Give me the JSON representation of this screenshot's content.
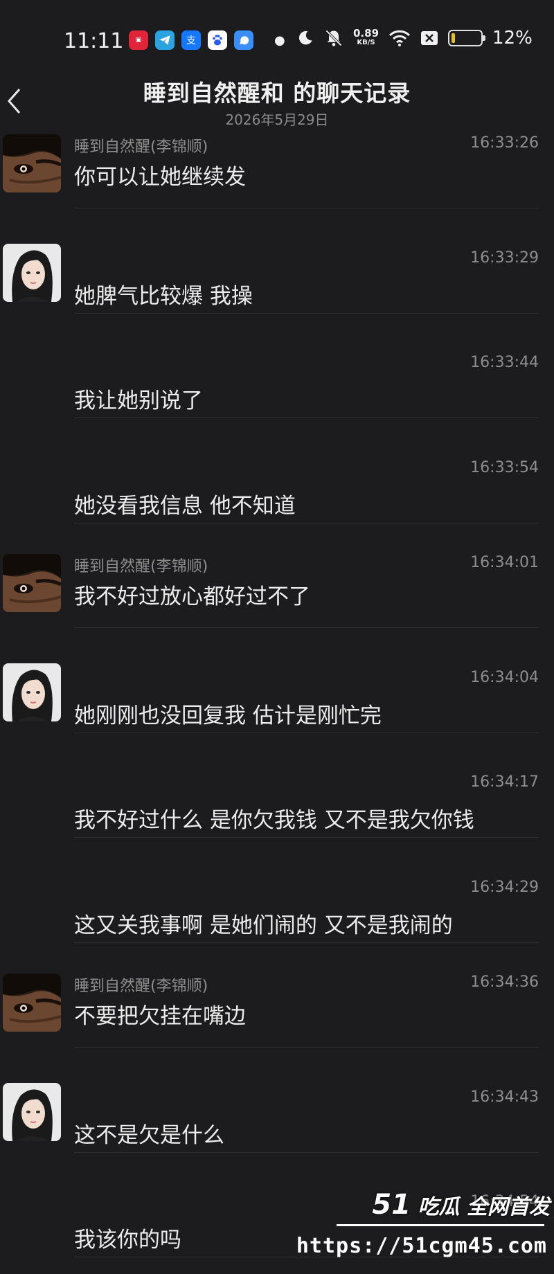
{
  "status_bar": {
    "time": "11:11",
    "net_speed": "0.89",
    "net_unit": "KB/S",
    "battery_percent": "12%",
    "battery_level": 0.12,
    "app_icons": [
      "mini-app-icon",
      "telegram-icon",
      "alipay-icon",
      "baidu-icon",
      "messenger-icon"
    ],
    "app_icon_alipay_glyph": "支"
  },
  "header": {
    "title": "睡到自然醒和   的聊天记录",
    "date": "2026年5月29日"
  },
  "messages": [
    {
      "sender": "睡到自然醒(李锦顺)",
      "time": "16:33:26",
      "text": "你可以让她继续发",
      "avatar": "man"
    },
    {
      "sender": "",
      "time": "16:33:29",
      "text": "她脾气比较爆 我操",
      "avatar": "woman"
    },
    {
      "sender": "",
      "time": "16:33:44",
      "text": "我让她别说了",
      "avatar": ""
    },
    {
      "sender": "",
      "time": "16:33:54",
      "text": "她没看我信息 他不知道",
      "avatar": ""
    },
    {
      "sender": "睡到自然醒(李锦顺)",
      "time": "16:34:01",
      "text": "我不好过放心都好过不了",
      "avatar": "man"
    },
    {
      "sender": "",
      "time": "16:34:04",
      "text": "她刚刚也没回复我 估计是刚忙完",
      "avatar": "woman"
    },
    {
      "sender": "",
      "time": "16:34:17",
      "text": "我不好过什么 是你欠我钱 又不是我欠你钱",
      "avatar": ""
    },
    {
      "sender": "",
      "time": "16:34:29",
      "text": "这又关我事啊 是她们闹的 又不是我闹的",
      "avatar": ""
    },
    {
      "sender": "睡到自然醒(李锦顺)",
      "time": "16:34:36",
      "text": "不要把欠挂在嘴边",
      "avatar": "man"
    },
    {
      "sender": "",
      "time": "16:34:43",
      "text": "这不是欠是什么",
      "avatar": "woman"
    },
    {
      "sender": "",
      "time": "16:34:54",
      "text": "我该你的吗",
      "avatar": ""
    }
  ],
  "watermark": {
    "logo_num": "51",
    "logo_text": "吃瓜 全网首发",
    "url": "https://51cgm45.com"
  },
  "colors": {
    "background": "#1c1c1e",
    "text_primary": "#ececec",
    "text_secondary": "#8e8e8e",
    "divider": "#2e2e30",
    "battery_fill": "#e8c21c"
  }
}
